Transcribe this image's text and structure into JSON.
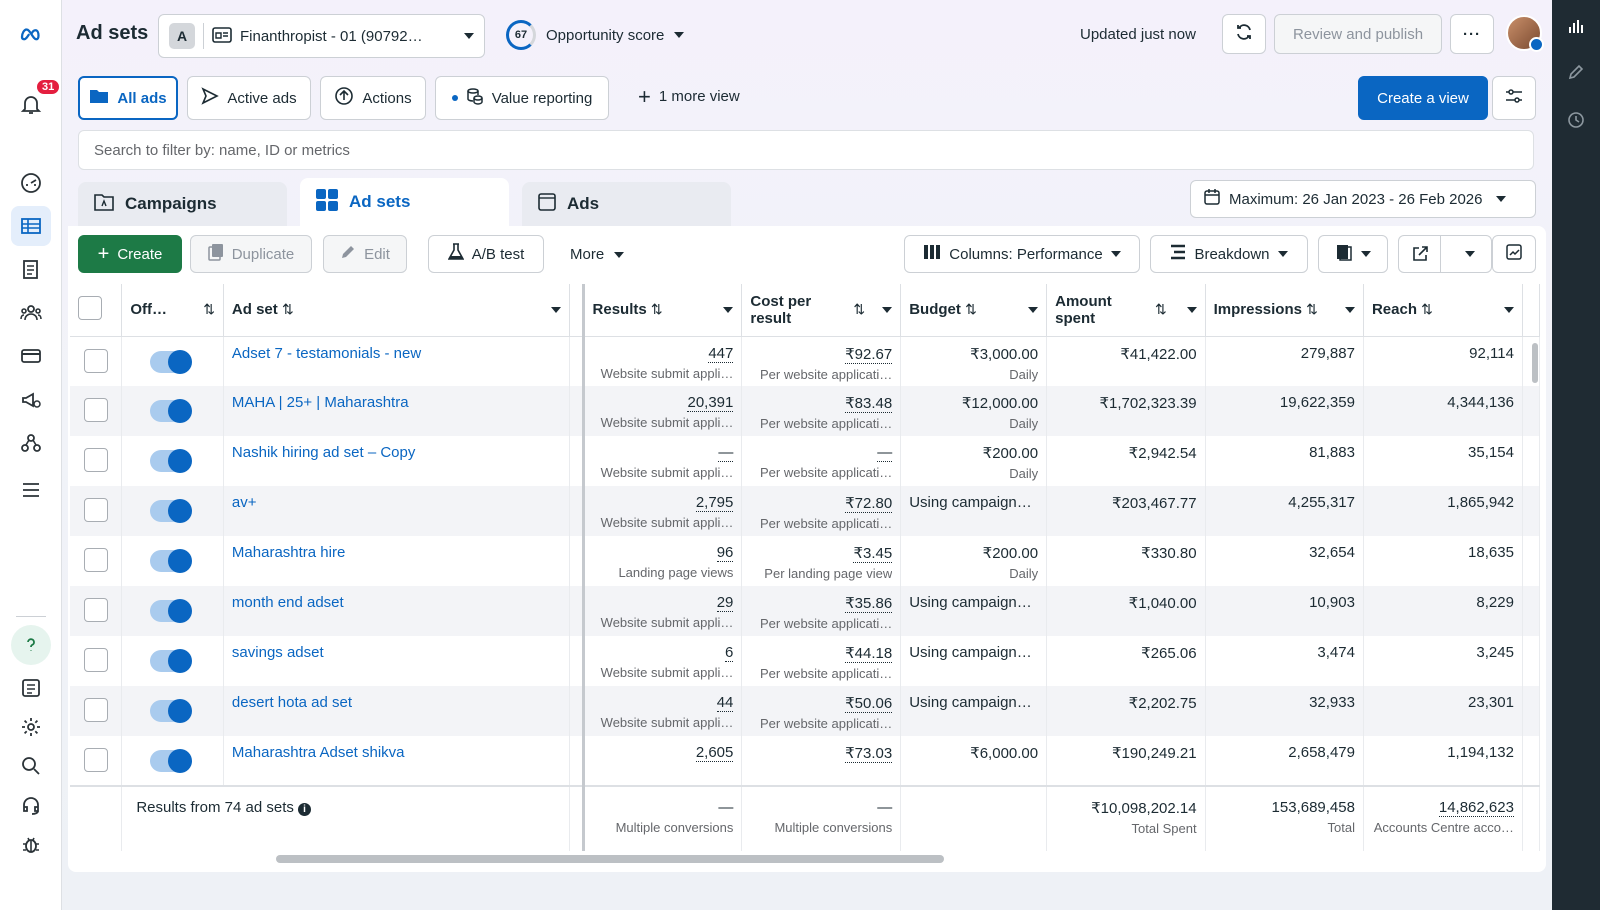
{
  "app": {
    "title": "Ad sets",
    "updated": "Updated just now"
  },
  "left_nav": {
    "notifications_count": "31",
    "icons": [
      "meta-logo",
      "notifications-bell",
      "dashboard-gauge",
      "ads-manager-table",
      "pages",
      "audiences",
      "billing-card",
      "campaign-megaphone",
      "integrations",
      "menu",
      "help",
      "reports",
      "settings",
      "search",
      "support",
      "debug"
    ]
  },
  "account": {
    "avatar_letter": "A",
    "name": "Finanthropist - 01 (90792…"
  },
  "opportunity": {
    "score": "67",
    "label": "Opportunity score"
  },
  "actions": {
    "review_publish": "Review and publish",
    "more": "···"
  },
  "views": {
    "all_ads": "All ads",
    "active_ads": "Active ads",
    "actions": "Actions",
    "value_reporting": "Value reporting",
    "more_view": "1 more view",
    "create_view": "Create a view"
  },
  "search": {
    "placeholder": "Search to filter by: name, ID or metrics"
  },
  "tabs": {
    "campaigns": "Campaigns",
    "adsets": "Ad sets",
    "ads": "Ads"
  },
  "date_range": "Maximum: 26 Jan 2023 - 26 Feb 2026",
  "toolbar": {
    "create": "Create",
    "duplicate": "Duplicate",
    "edit": "Edit",
    "ab_test": "A/B test",
    "more": "More",
    "columns": "Columns: Performance",
    "breakdown": "Breakdown"
  },
  "columns": {
    "off": "Off…",
    "adset": "Ad set",
    "results": "Results",
    "cpr": "Cost per result",
    "budget": "Budget",
    "amount": "Amount spent",
    "impressions": "Impressions",
    "reach": "Reach"
  },
  "rows": [
    {
      "name": "Adset 7 - testamonials - new",
      "results": "447",
      "results_sub": "Website submit appli…",
      "cpr": "₹92.67",
      "cpr_sub": "Per website applicati…",
      "budget": "₹3,000.00",
      "budget_sub": "Daily",
      "amount": "₹41,422.00",
      "impressions": "279,887",
      "reach": "92,114"
    },
    {
      "name": "MAHA | 25+ | Maharashtra",
      "results": "20,391",
      "results_sub": "Website submit appli…",
      "cpr": "₹83.48",
      "cpr_sub": "Per website applicati…",
      "budget": "₹12,000.00",
      "budget_sub": "Daily",
      "amount": "₹1,702,323.39",
      "impressions": "19,622,359",
      "reach": "4,344,136"
    },
    {
      "name": "Nashik hiring ad set – Copy",
      "results": "—",
      "results_sub": "Website submit appli…",
      "cpr": "—",
      "cpr_sub": "Per website applicati…",
      "budget": "₹200.00",
      "budget_sub": "Daily",
      "amount": "₹2,942.54",
      "impressions": "81,883",
      "reach": "35,154"
    },
    {
      "name": "av+",
      "results": "2,795",
      "results_sub": "Website submit appli…",
      "cpr": "₹72.80",
      "cpr_sub": "Per website applicati…",
      "budget": "Using campaign…",
      "budget_sub": "",
      "amount": "₹203,467.77",
      "impressions": "4,255,317",
      "reach": "1,865,942"
    },
    {
      "name": "Maharashtra hire",
      "results": "96",
      "results_sub": "Landing page views",
      "cpr": "₹3.45",
      "cpr_sub": "Per landing page view",
      "budget": "₹200.00",
      "budget_sub": "Daily",
      "amount": "₹330.80",
      "impressions": "32,654",
      "reach": "18,635"
    },
    {
      "name": "month end adset",
      "results": "29",
      "results_sub": "Website submit appli…",
      "cpr": "₹35.86",
      "cpr_sub": "Per website applicati…",
      "budget": "Using campaign…",
      "budget_sub": "",
      "amount": "₹1,040.00",
      "impressions": "10,903",
      "reach": "8,229"
    },
    {
      "name": "savings adset",
      "results": "6",
      "results_sub": "Website submit appli…",
      "cpr": "₹44.18",
      "cpr_sub": "Per website applicati…",
      "budget": "Using campaign…",
      "budget_sub": "",
      "amount": "₹265.06",
      "impressions": "3,474",
      "reach": "3,245"
    },
    {
      "name": "desert hota ad set",
      "results": "44",
      "results_sub": "Website submit appli…",
      "cpr": "₹50.06",
      "cpr_sub": "Per website applicati…",
      "budget": "Using campaign…",
      "budget_sub": "",
      "amount": "₹2,202.75",
      "impressions": "32,933",
      "reach": "23,301"
    },
    {
      "name": "Maharashtra Adset shikva",
      "results": "2,605",
      "results_sub": "",
      "cpr": "₹73.03",
      "cpr_sub": "",
      "budget": "₹6,000.00",
      "budget_sub": "",
      "amount": "₹190,249.21",
      "impressions": "2,658,479",
      "reach": "1,194,132"
    }
  ],
  "footer": {
    "label": "Results from 74 ad sets",
    "results": "—",
    "results_sub": "Multiple conversions",
    "cpr": "—",
    "cpr_sub": "Multiple conversions",
    "amount": "₹10,098,202.14",
    "amount_sub": "Total Spent",
    "impressions": "153,689,458",
    "impressions_sub": "Total",
    "reach": "14,862,623",
    "reach_sub": "Accounts Centre acco…"
  },
  "colors": {
    "accent": "#0a66c2",
    "create": "#1d7a46",
    "badge": "#e41e3f"
  }
}
